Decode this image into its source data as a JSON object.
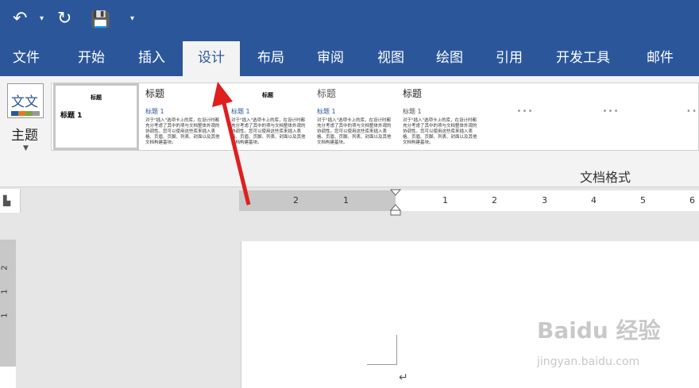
{
  "qat": {
    "undo": "↶",
    "redo": "↻",
    "save": "💾",
    "more": "▾"
  },
  "tabs": [
    "文件",
    "开始",
    "插入",
    "设计",
    "布局",
    "审阅",
    "视图",
    "绘图",
    "引用",
    "开发工具",
    "邮件"
  ],
  "ribbon": {
    "theme_icon_text": "文文",
    "theme_label": "主题",
    "group_label": "文档格式",
    "gallery": {
      "thumb1_head": "标题",
      "thumb1_bold": "标题 1",
      "thumb2_head": "标题",
      "thumb2_sub": "标题 1",
      "thumb2_body": "对于\"插入\"选项卡上的库，在设计时都充分考虑了其中的项与文档整体外观的协调性。您可以使用这些库来插入表格、页眉、页脚、列表、封面以及其他文档构建基块。",
      "thumb3_head": "标题",
      "thumb3_sub": "标题 1",
      "thumb3_body": "对于\"插入\"选项卡上的库，在设计时都充分考虑了其中的项与文档整体外观的协调性。您可以使用这些库来插入表格、页眉、页脚、列表、封面以及其他文档构建基块。",
      "thumb4_head": "标题",
      "thumb4_sub": "标题 1",
      "thumb4_body": "对于\"插入\"选项卡上的库，在设计时都充分考虑了其中的项与文档整体外观的协调性。您可以使用这些库来插入表格、页眉、页脚、列表、封面以及其他文档构建基块。",
      "thumb5_head": "标题",
      "thumb5_sub": "标题 1",
      "thumb5_body": "对于\"插入\"选项卡上的库，在设计时都充分考虑了其中的项与文档整体外观的协调性。您可以使用这些库来插入表格、页眉、页脚、列表、封面以及其他文档构建基块。"
    }
  },
  "ruler": {
    "corner": "▙",
    "h_left_nums": [
      "2",
      "1"
    ],
    "h_right_nums": [
      "1",
      "2",
      "3",
      "4",
      "5",
      "6"
    ],
    "v_nums": [
      "2",
      "1",
      "1"
    ]
  },
  "document": {
    "para_mark": "↵"
  },
  "watermark": {
    "main": "Baidu 经验",
    "sub": "jingyan.baidu.com"
  },
  "colors": {
    "brand": "#2b579a",
    "arrow": "#e01e1e"
  }
}
